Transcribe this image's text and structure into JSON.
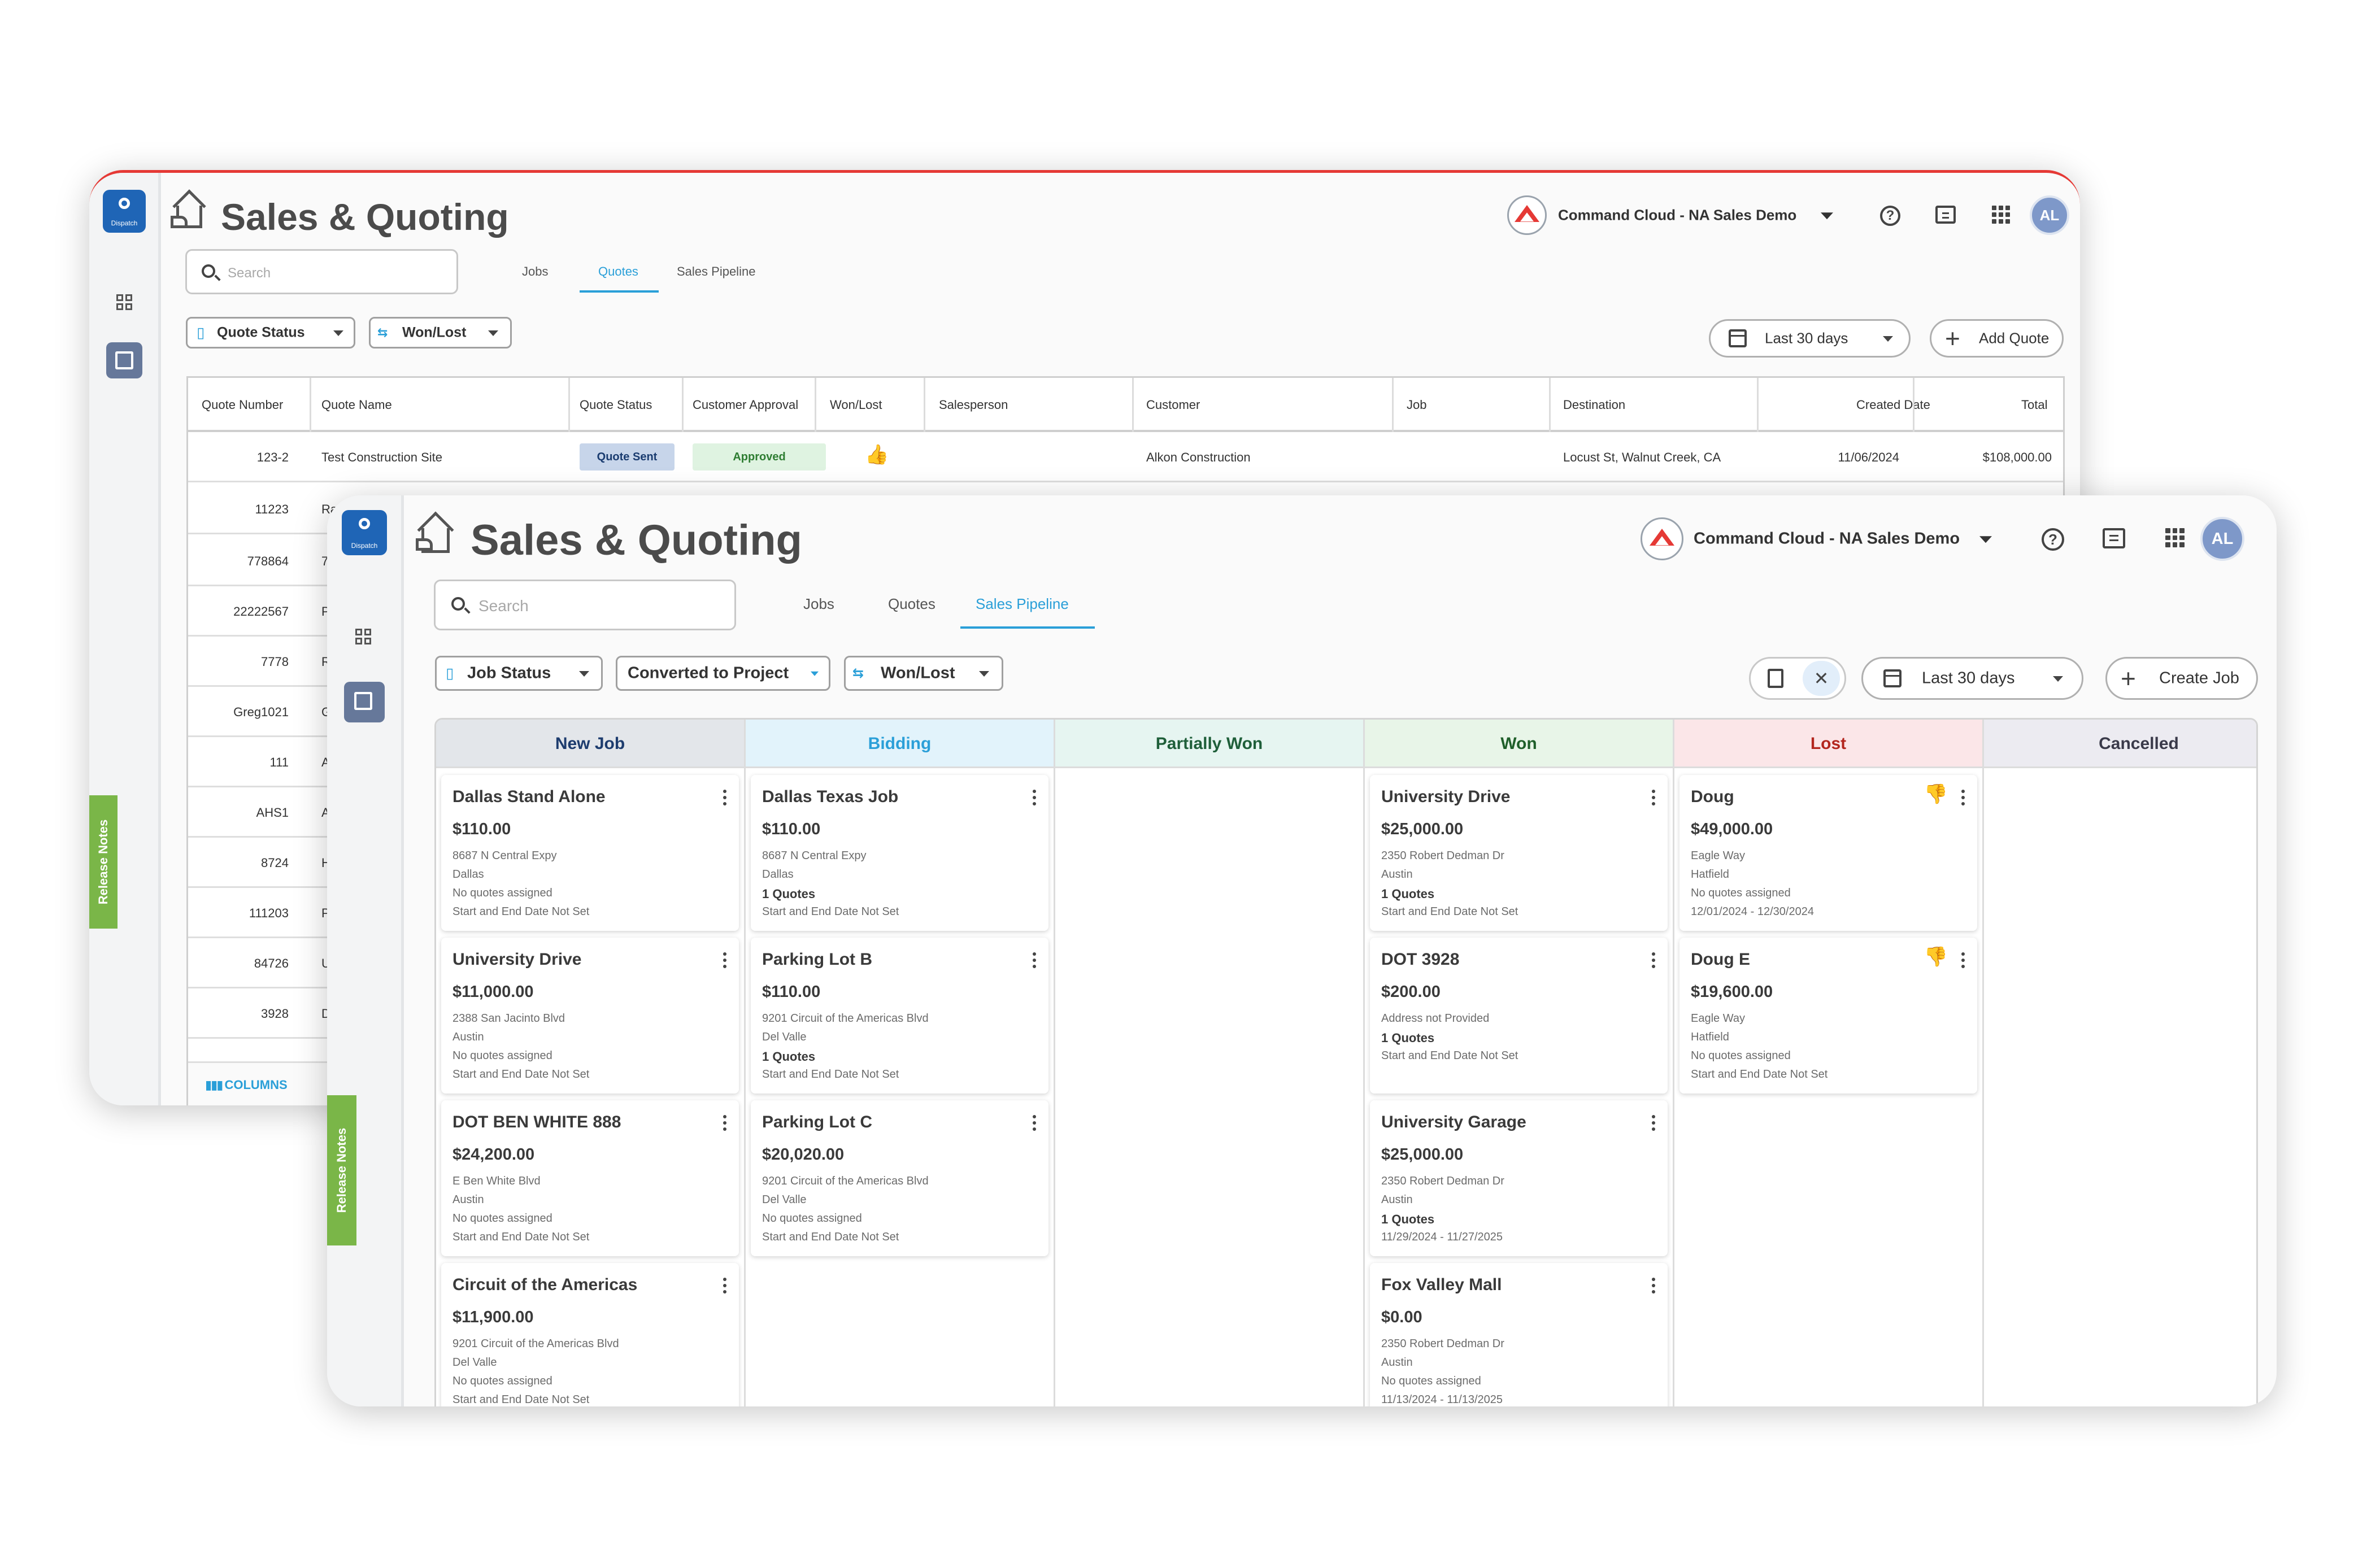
{
  "back_window": {
    "sidebar": {
      "logo_label": "Dispatch",
      "release_notes": "Release Notes"
    },
    "header": {
      "title": "Sales & Quoting",
      "org_name": "Command Cloud - NA Sales Demo",
      "avatar_initials": "AL"
    },
    "search": {
      "placeholder": "Search"
    },
    "tabs": [
      {
        "label": "Jobs"
      },
      {
        "label": "Quotes"
      },
      {
        "label": "Sales Pipeline"
      }
    ],
    "active_tab": "Quotes",
    "filters": {
      "quote_status": "Quote Status",
      "won_lost": "Won/Lost"
    },
    "date_range": "Last 30 days",
    "add_quote": "Add Quote",
    "table": {
      "columns": [
        "Quote Number",
        "Quote Name",
        "Quote Status",
        "Customer Approval",
        "Won/Lost",
        "Salesperson",
        "Customer",
        "Job",
        "Destination",
        "Created Date",
        "Total"
      ],
      "first_row": {
        "quote_number": "123-2",
        "quote_name": "Test Construction Site",
        "quote_status": "Quote Sent",
        "customer_approval": "Approved",
        "customer": "Alkon Construction",
        "destination": "Locust St, Walnut Creek, CA",
        "created_date": "11/06/2024",
        "total": "$108,000.00"
      },
      "rows": [
        {
          "quote_number": "11223",
          "name_initial": "Rac"
        },
        {
          "quote_number": "778864",
          "name_initial": "7"
        },
        {
          "quote_number": "22222567",
          "name_initial": "P"
        },
        {
          "quote_number": "7778",
          "name_initial": "R"
        },
        {
          "quote_number": "Greg1021",
          "name_initial": "G"
        },
        {
          "quote_number": "111",
          "name_initial": "A"
        },
        {
          "quote_number": "AHS1",
          "name_initial": "A"
        },
        {
          "quote_number": "8724",
          "name_initial": "H"
        },
        {
          "quote_number": "111203",
          "name_initial": "P"
        },
        {
          "quote_number": "84726",
          "name_initial": "U"
        },
        {
          "quote_number": "3928",
          "name_initial": "D"
        }
      ],
      "columns_button": "COLUMNS"
    }
  },
  "front_window": {
    "sidebar": {
      "logo_label": "Dispatch",
      "release_notes": "Release Notes"
    },
    "header": {
      "title": "Sales & Quoting",
      "org_name": "Command Cloud - NA Sales Demo",
      "avatar_initials": "AL"
    },
    "search": {
      "placeholder": "Search"
    },
    "tabs": [
      {
        "label": "Jobs"
      },
      {
        "label": "Quotes"
      },
      {
        "label": "Sales Pipeline"
      }
    ],
    "active_tab": "Sales Pipeline",
    "filters": {
      "job_status": "Job Status",
      "converted": "Converted to Project",
      "won_lost": "Won/Lost"
    },
    "date_range": "Last 30 days",
    "create_job": "Create Job",
    "columns": [
      {
        "title": "New Job",
        "bg": "#e3e6ea",
        "color": "#1d3c6e",
        "cards": [
          {
            "name": "Dallas Stand Alone",
            "amount": "$110.00",
            "lines": [
              "8687 N Central Expy",
              "Dallas",
              "No quotes assigned",
              "Start and End Date Not Set"
            ],
            "bold": []
          },
          {
            "name": "University Drive",
            "amount": "$11,000.00",
            "lines": [
              "2388 San Jacinto Blvd",
              "Austin",
              "No quotes assigned",
              "Start and End Date Not Set"
            ],
            "bold": []
          },
          {
            "name": "DOT BEN WHITE 888",
            "amount": "$24,200.00",
            "lines": [
              "E Ben White Blvd",
              "Austin",
              "No quotes assigned",
              "Start and End Date Not Set"
            ],
            "bold": []
          },
          {
            "name": "Circuit of the Americas",
            "amount": "$11,900.00",
            "lines": [
              "9201 Circuit of the Americas Blvd",
              "Del Valle",
              "No quotes assigned",
              "Start and End Date Not Set"
            ],
            "bold": []
          }
        ]
      },
      {
        "title": "Bidding",
        "bg": "#e2f3fb",
        "color": "#2a9fd8",
        "cards": [
          {
            "name": "Dallas Texas Job",
            "amount": "$110.00",
            "lines": [
              "8687 N Central Expy",
              "Dallas",
              "1 Quotes",
              "Start and End Date Not Set"
            ],
            "bold": [
              2
            ]
          },
          {
            "name": "Parking Lot B",
            "amount": "$110.00",
            "lines": [
              "9201 Circuit of the Americas Blvd",
              "Del Valle",
              "1 Quotes",
              "Start and End Date Not Set"
            ],
            "bold": [
              2
            ]
          },
          {
            "name": "Parking Lot C",
            "amount": "$20,020.00",
            "lines": [
              "9201 Circuit of the Americas Blvd",
              "Del Valle",
              "No quotes assigned",
              "Start and End Date Not Set"
            ],
            "bold": []
          }
        ]
      },
      {
        "title": "Partially Won",
        "bg": "#e6f5f1",
        "color": "#1f5f3a",
        "cards": []
      },
      {
        "title": "Won",
        "bg": "#e8f5e8",
        "color": "#1f5f2a",
        "cards": [
          {
            "name": "University Drive",
            "amount": "$25,000.00",
            "lines": [
              "2350 Robert Dedman Dr",
              "Austin",
              "1 Quotes",
              "Start and End Date Not Set"
            ],
            "bold": [
              2
            ]
          },
          {
            "name": "DOT 3928",
            "amount": "$200.00",
            "lines": [
              "Address not Provided",
              "1 Quotes",
              "Start and End Date Not Set"
            ],
            "bold": [
              1
            ]
          },
          {
            "name": "University Garage",
            "amount": "$25,000.00",
            "lines": [
              "2350 Robert Dedman Dr",
              "Austin",
              "1 Quotes",
              "11/29/2024 - 11/27/2025"
            ],
            "bold": [
              2
            ]
          },
          {
            "name": "Fox Valley Mall",
            "amount": "$0.00",
            "lines": [
              "2350 Robert Dedman Dr",
              "Austin",
              "No quotes assigned",
              "11/13/2024 - 11/13/2025"
            ],
            "bold": []
          }
        ]
      },
      {
        "title": "Lost",
        "bg": "#fbe6e8",
        "color": "#b3261e",
        "cards": [
          {
            "name": "Doug",
            "amount": "$49,000.00",
            "lines": [
              "Eagle Way",
              "Hatfield",
              "No quotes assigned",
              "12/01/2024 - 12/30/2024"
            ],
            "bold": [],
            "lost": true
          },
          {
            "name": "Doug E",
            "amount": "$19,600.00",
            "lines": [
              "Eagle Way",
              "Hatfield",
              "No quotes assigned",
              "Start and End Date Not Set"
            ],
            "bold": [],
            "lost": true
          }
        ]
      },
      {
        "title": "Cancelled",
        "bg": "#ecebf1",
        "color": "#3a3a4a",
        "cards": []
      }
    ]
  },
  "colors": {
    "accent": "#2a9fd8",
    "brand_red": "#e53935",
    "release_green": "#7ab648"
  }
}
